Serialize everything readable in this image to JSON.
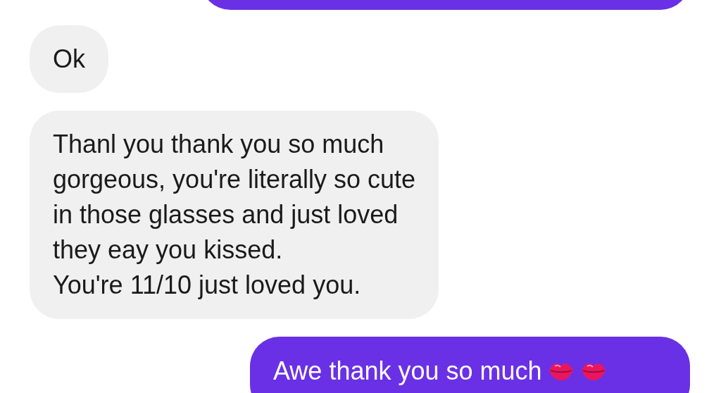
{
  "messages": [
    {
      "kind": "sent"
    },
    {
      "kind": "received",
      "lines": [
        "Ok"
      ]
    },
    {
      "kind": "received",
      "lines": [
        "Thanl you thank you so much",
        "gorgeous, you're literally so cute",
        "in those glasses and just loved",
        "they eay you kissed.",
        "You're 11/10 just loved you."
      ]
    },
    {
      "kind": "sent",
      "lines": [
        "Awe thank you so much"
      ],
      "icons": [
        {
          "kind": "lips"
        },
        {
          "kind": "lips"
        }
      ]
    }
  ]
}
